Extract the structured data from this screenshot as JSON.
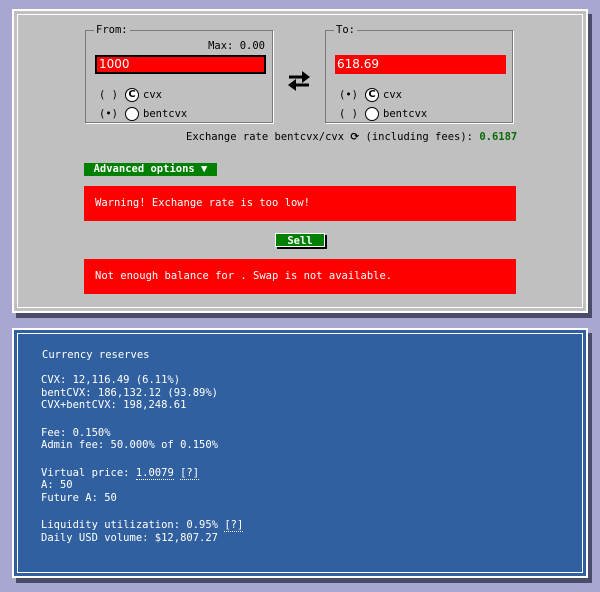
{
  "swap": {
    "from_legend": "From:",
    "to_legend": "To:",
    "max_label": "Max: 0.00",
    "from_amount": "1000",
    "to_amount": "618.69",
    "from_options": [
      {
        "radio": "( )",
        "label": "cvx"
      },
      {
        "radio": "(•)",
        "label": "bentcvx"
      }
    ],
    "to_options": [
      {
        "radio": "(•)",
        "label": "cvx"
      },
      {
        "radio": "( )",
        "label": "bentcvx"
      }
    ],
    "rate_prefix": "Exchange rate bentcvx/cvx",
    "rate_suffix": "(including fees):",
    "rate_value": "0.6187",
    "advanced_label": "Advanced options ▼",
    "warning_text": "Warning! Exchange rate is too low!",
    "sell_label": "Sell",
    "balance_error": "Not enough balance for . Swap is not available."
  },
  "reserves": {
    "title": "Currency reserves",
    "cvx": "CVX: 12,116.49 (6.11%)",
    "bentcvx": "bentCVX: 186,132.12 (93.89%)",
    "total": "CVX+bentCVX: 198,248.61",
    "fee": "Fee: 0.150%",
    "admin_fee": "Admin fee: 50.000% of 0.150%",
    "virtual_price_label": "Virtual price:",
    "virtual_price_value": "1.0079",
    "help1": "[?]",
    "a": "A: 50",
    "future_a": "Future A: 50",
    "liquidity_label": "Liquidity utilization: 0.95%",
    "help2": "[?]",
    "daily_volume": "Daily USD volume: $12,807.27"
  },
  "colors": {
    "page_bg": "#a7a7d1",
    "panel_gray": "#c0c0c0",
    "panel_blue": "#3060a0",
    "alert_red": "#ff0000",
    "button_green": "#008000",
    "rate_green": "#0a6a0a"
  },
  "icons": {
    "coin": "cvx-coin-icon",
    "swap": "swap-arrows-icon",
    "refresh": "refresh-icon"
  }
}
